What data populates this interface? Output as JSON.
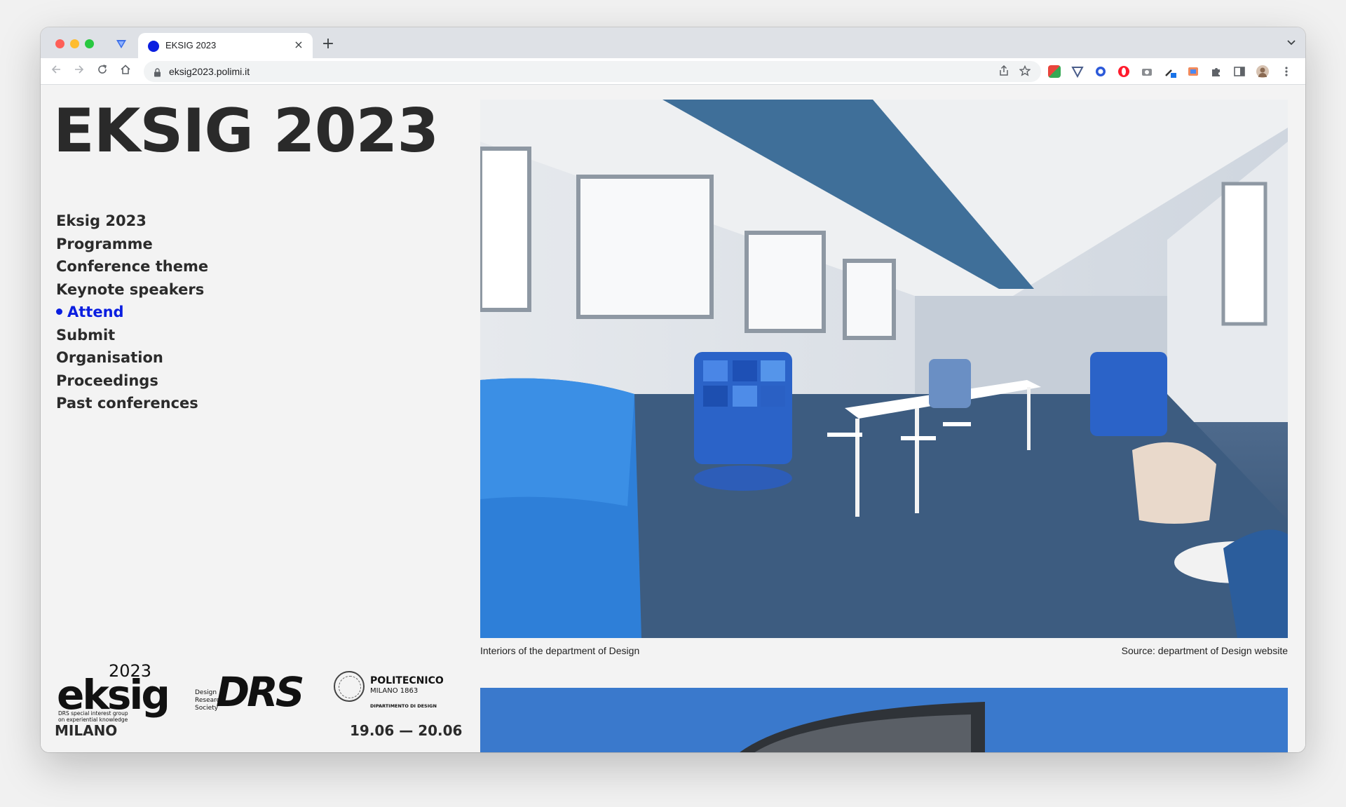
{
  "browser": {
    "tab_title": "EKSIG 2023",
    "url": "eksig2023.polimi.it",
    "new_tab_symbol": "+",
    "close_symbol": "×",
    "icons": [
      "ext-tab-icon",
      "back-icon",
      "forward-icon",
      "reload-icon",
      "home-icon",
      "lock-icon",
      "share-icon",
      "star-icon",
      "extension-icons",
      "puzzle-icon",
      "sidebar-icon",
      "profile-avatar",
      "menu-icon"
    ],
    "accent_color": "#0a1ee0"
  },
  "site": {
    "title": "EKSIG 2023",
    "nav": [
      {
        "label": "Eksig 2023",
        "active": false
      },
      {
        "label": "Programme",
        "active": false
      },
      {
        "label": "Conference theme",
        "active": false
      },
      {
        "label": "Keynote speakers",
        "active": false
      },
      {
        "label": "Attend",
        "active": true
      },
      {
        "label": "Submit",
        "active": false
      },
      {
        "label": "Organisation",
        "active": false
      },
      {
        "label": "Proceedings",
        "active": false
      },
      {
        "label": "Past conferences",
        "active": false
      }
    ],
    "logos": {
      "eksig_year": "2023",
      "eksig_word": "eksig",
      "eksig_sub": "DRS special interest group on experiential knowledge",
      "drs_small": "Design Research Society",
      "drs_big": "DRS",
      "polimi_name": "POLITECNICO",
      "polimi_city": "MILANO 1863",
      "polimi_dept": "DIPARTIMENTO DI DESIGN"
    },
    "footer": {
      "city": "MILANO",
      "dates": "19.06 — 20.06"
    },
    "hero": {
      "caption_left": "Interiors of the department of Design",
      "caption_right": "Source: department of Design website"
    }
  }
}
